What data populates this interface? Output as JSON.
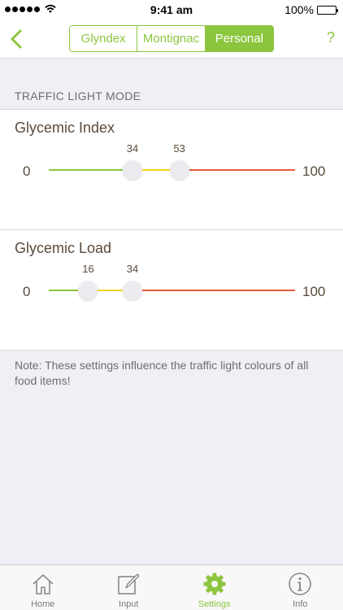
{
  "status_bar": {
    "time": "9:41 am",
    "battery_percent": "100%",
    "battery_level": 1.0
  },
  "nav": {
    "back_icon": "chevron-left-icon",
    "help_label": "?",
    "tabs": [
      {
        "label": "Glyndex",
        "active": false
      },
      {
        "label": "Montignac",
        "active": false
      },
      {
        "label": "Personal",
        "active": true
      }
    ]
  },
  "section": {
    "title": "TRAFFIC LIGHT MODE"
  },
  "sliders": [
    {
      "title": "Glycemic Index",
      "min_label": "0",
      "max_label": "100",
      "low": "34",
      "high": "53"
    },
    {
      "title": "Glycemic Load",
      "min_label": "0",
      "max_label": "100",
      "low": "16",
      "high": "34"
    }
  ],
  "note": "Note: These settings influence the traffic light colours of all food items!",
  "tab_bar": {
    "items": [
      {
        "label": "Home",
        "icon": "home-icon",
        "active": false
      },
      {
        "label": "Input",
        "icon": "edit-icon",
        "active": false
      },
      {
        "label": "Settings",
        "icon": "gear-icon",
        "active": true
      },
      {
        "label": "Info",
        "icon": "info-icon",
        "active": false
      }
    ]
  },
  "colors": {
    "accent": "#8cc63f",
    "yellow": "#f3d31a",
    "red": "#e65a3a",
    "text": "#5a4a3a"
  }
}
